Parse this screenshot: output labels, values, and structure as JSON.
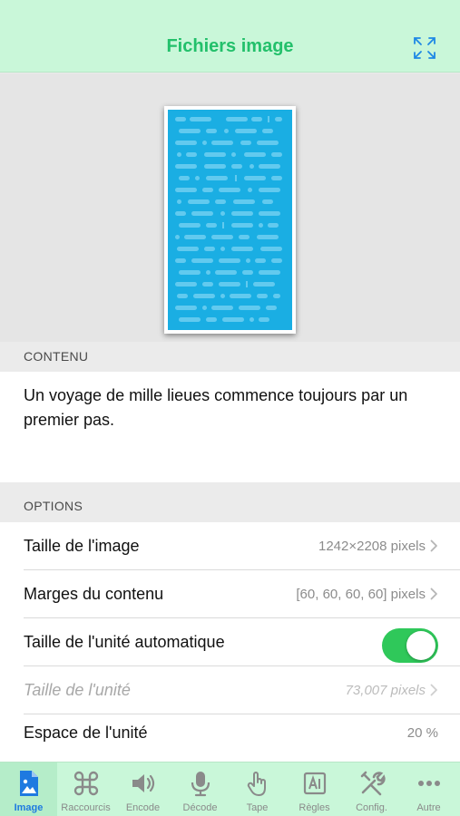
{
  "navbar": {
    "title": "Fichiers image",
    "expand_icon": "expand-arrows-icon",
    "title_color": "#23c06b"
  },
  "preview": {
    "image_color": "#1aaee3",
    "image_description_icon": "code-image"
  },
  "content": {
    "header": "CONTENU",
    "text": "Un voyage de mille lieues commence toujours par un premier pas."
  },
  "options": {
    "header": "OPTIONS",
    "rows": [
      {
        "label": "Taille de l'image",
        "value": "1242×2208 pixels"
      },
      {
        "label": "Marges du contenu",
        "value": "[60, 60, 60, 60] pixels"
      },
      {
        "label": "Taille de l'unité automatique",
        "toggle_on": true
      },
      {
        "label": "Taille de l'unité",
        "value": "73,007 pixels",
        "disabled": true
      },
      {
        "label": "Espace de l'unité",
        "value": "20 %"
      }
    ]
  },
  "tabbar": {
    "active_color": "#1e7ae0",
    "tabs": [
      {
        "label": "Image",
        "icon": "image-file-icon",
        "active": true
      },
      {
        "label": "Raccourcis",
        "icon": "command-icon"
      },
      {
        "label": "Encode",
        "icon": "speaker-icon"
      },
      {
        "label": "Décode",
        "icon": "microphone-icon"
      },
      {
        "label": "Tape",
        "icon": "hand-tap-icon"
      },
      {
        "label": "Règles",
        "icon": "rules-icon"
      },
      {
        "label": "Config.",
        "icon": "tools-icon"
      },
      {
        "label": "Autre",
        "icon": "more-icon"
      }
    ]
  }
}
